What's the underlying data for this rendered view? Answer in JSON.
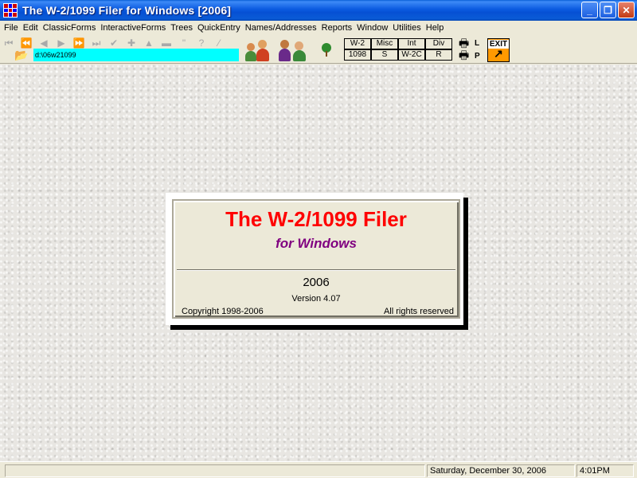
{
  "window": {
    "title": "The W-2/1099 Filer for Windows [2006]",
    "minimize": "_",
    "restore": "❐",
    "close": "✕"
  },
  "menu": {
    "items": [
      "File",
      "Edit",
      "ClassicForms",
      "InteractiveForms",
      "Trees",
      "QuickEntry",
      "Names/Addresses",
      "Reports",
      "Window",
      "Utilities",
      "Help"
    ]
  },
  "toolbar": {
    "path": "d:\\06w21099",
    "form_buttons": [
      "W-2",
      "Misc",
      "Int",
      "Div",
      "1098",
      "S",
      "W-2C",
      "R"
    ],
    "printer_landscape_label": "L",
    "printer_portrait_label": "P",
    "exit_label": "EXIT",
    "nav_icons": [
      "first-record-icon",
      "prev-page-icon",
      "prev-icon",
      "next-icon",
      "next-page-icon",
      "last-record-icon",
      "check-icon",
      "plus-icon",
      "up-icon",
      "minus-icon",
      "quote-icon",
      "help-icon",
      "delete-icon"
    ]
  },
  "splash": {
    "title": "The W-2/1099 Filer",
    "subtitle": "for Windows",
    "year": "2006",
    "version": "Version 4.07",
    "copyright": "Copyright 1998-2006",
    "rights": "All rights reserved"
  },
  "status": {
    "date": "Saturday, December 30, 2006",
    "time": "4:01PM"
  },
  "colors": {
    "splash_title": "#ff0000",
    "splash_subtitle": "#800080",
    "path_field": "#00ffff",
    "exit_button": "#ff9900"
  }
}
